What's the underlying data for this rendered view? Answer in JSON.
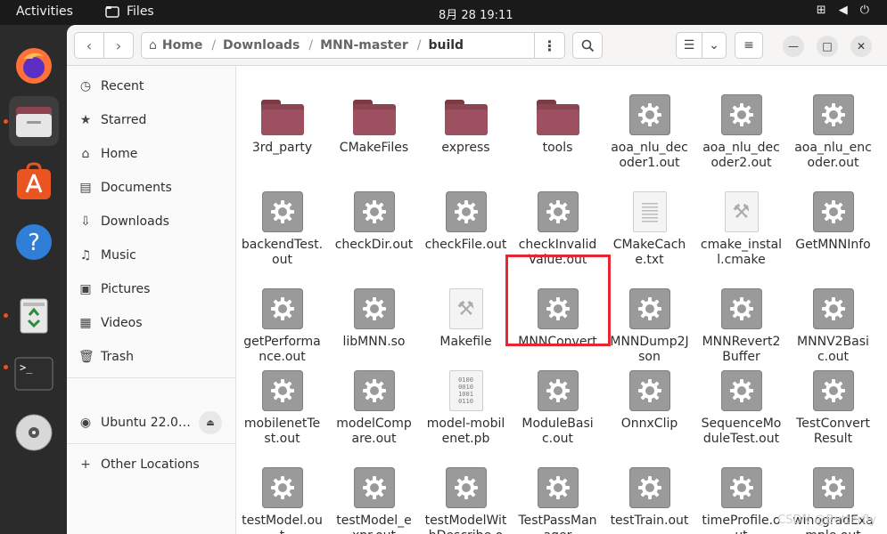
{
  "topbar": {
    "activities": "Activities",
    "app_name": "Files",
    "clock": "8月 28  19:11",
    "tray_icons": [
      "network-icon",
      "volume-icon",
      "power-icon"
    ]
  },
  "dock": {
    "items": [
      {
        "name": "firefox",
        "icon": "firefox-icon"
      },
      {
        "name": "files",
        "icon": "files-icon",
        "active": true
      },
      {
        "name": "software",
        "icon": "app-store-icon"
      },
      {
        "name": "help",
        "icon": "help-icon"
      },
      {
        "name": "trash",
        "icon": "trash-icon"
      },
      {
        "name": "terminal",
        "icon": "terminal-icon"
      },
      {
        "name": "disc",
        "icon": "disc-icon"
      }
    ]
  },
  "headerbar": {
    "path": [
      "Home",
      "Downloads",
      "MNN-master",
      "build"
    ]
  },
  "sidebar": {
    "items": [
      "Recent",
      "Starred",
      "Home",
      "Documents",
      "Downloads",
      "Music",
      "Pictures",
      "Videos",
      "Trash"
    ],
    "device": "Ubuntu 22.0…",
    "other": "Other Locations"
  },
  "files": [
    {
      "label": "3rd_party",
      "type": "folder"
    },
    {
      "label": "CMakeFiles",
      "type": "folder"
    },
    {
      "label": "express",
      "type": "folder"
    },
    {
      "label": "tools",
      "type": "folder"
    },
    {
      "label": "aoa_nlu_decoder1.out",
      "type": "exec"
    },
    {
      "label": "aoa_nlu_decoder2.out",
      "type": "exec"
    },
    {
      "label": "aoa_nlu_encoder.out",
      "type": "exec"
    },
    {
      "label": "backendTest.out",
      "type": "exec"
    },
    {
      "label": "checkDir.out",
      "type": "exec"
    },
    {
      "label": "checkFile.out",
      "type": "exec"
    },
    {
      "label": "checkInvalidValue.out",
      "type": "exec"
    },
    {
      "label": "CMakeCache.txt",
      "type": "text"
    },
    {
      "label": "cmake_install.cmake",
      "type": "script"
    },
    {
      "label": "GetMNNInfo",
      "type": "exec"
    },
    {
      "label": "getPerformance.out",
      "type": "exec"
    },
    {
      "label": "libMNN.so",
      "type": "exec"
    },
    {
      "label": "Makefile",
      "type": "script"
    },
    {
      "label": "MNNConvert",
      "type": "exec"
    },
    {
      "label": "MNNDump2Json",
      "type": "exec"
    },
    {
      "label": "MNNRevert2Buffer",
      "type": "exec"
    },
    {
      "label": "MNNV2Basic.out",
      "type": "exec"
    },
    {
      "label": "mobilenetTest.out",
      "type": "exec"
    },
    {
      "label": "modelCompare.out",
      "type": "exec"
    },
    {
      "label": "model-mobilenet.pb",
      "type": "binary"
    },
    {
      "label": "ModuleBasic.out",
      "type": "exec"
    },
    {
      "label": "OnnxClip",
      "type": "exec"
    },
    {
      "label": "SequenceModuleTest.out",
      "type": "exec"
    },
    {
      "label": "TestConvertResult",
      "type": "exec"
    },
    {
      "label": "testModel.out",
      "type": "exec"
    },
    {
      "label": "testModel_expr.out",
      "type": "exec"
    },
    {
      "label": "testModelWithDescribe.out",
      "type": "exec"
    },
    {
      "label": "TestPassManager",
      "type": "exec"
    },
    {
      "label": "testTrain.out",
      "type": "exec"
    },
    {
      "label": "timeProfile.out",
      "type": "exec"
    },
    {
      "label": "winogradExample.out",
      "type": "exec"
    }
  ],
  "highlighted": "MNNConvert",
  "binary_glyph": "0100\n0010\n1001\n0110",
  "watermark": "CSDN @Butterfly",
  "colors": {
    "folder": "#8c4450",
    "highlight": "#e8262f",
    "accent": "#e95420"
  }
}
